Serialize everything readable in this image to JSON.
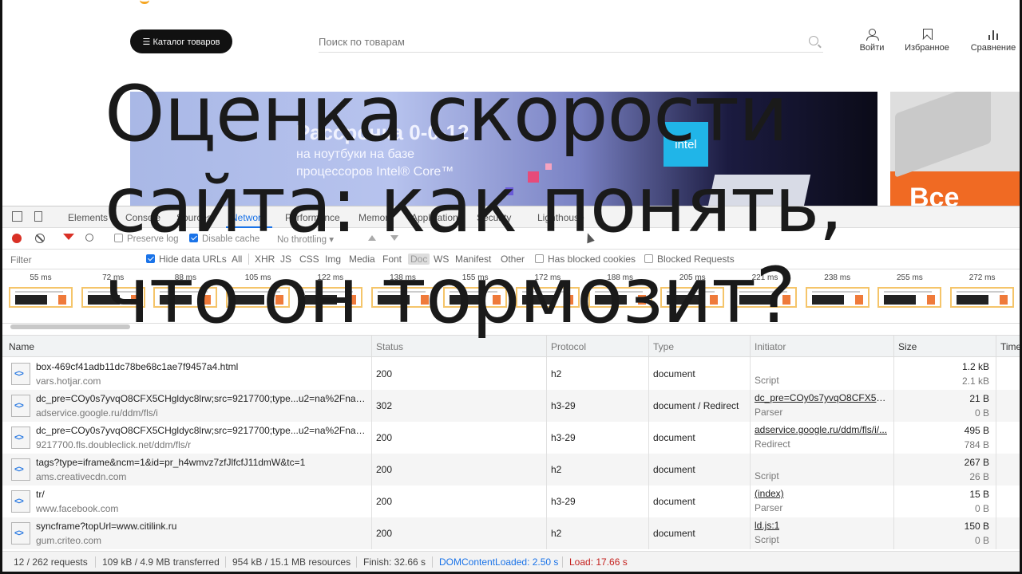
{
  "site": {
    "catalog_label": "☰ Каталог товаров",
    "search_placeholder": "Поиск по товарам",
    "actions": {
      "login": "Войти",
      "favorites": "Избранное",
      "compare": "Сравнение"
    },
    "banner": {
      "title": "Рассрочка 0-0-12",
      "line1": "на ноутбуки на базе",
      "line2": "процессоров Intel® Core™",
      "badge": "intel"
    },
    "side_banner": {
      "text": "Все"
    }
  },
  "devtools": {
    "tabs": [
      "Elements",
      "Console",
      "Sources",
      "Network",
      "Performance",
      "Memory",
      "Application",
      "Security",
      "Lighthouse"
    ],
    "active_tab": "Network",
    "toolbar": {
      "preserve_log": "Preserve log",
      "disable_cache": "Disable cache",
      "throttling": "No throttling"
    },
    "filter": {
      "placeholder": "Filter",
      "hide_data_urls": "Hide data URLs",
      "types": [
        "All",
        "XHR",
        "JS",
        "CSS",
        "Img",
        "Media",
        "Font",
        "Doc",
        "WS",
        "Manifest",
        "Other"
      ],
      "selected_type": "Doc",
      "has_blocked_cookies": "Has blocked cookies",
      "blocked_requests": "Blocked Requests"
    },
    "filmstrip": [
      "55 ms",
      "72 ms",
      "88 ms",
      "105 ms",
      "122 ms",
      "138 ms",
      "155 ms",
      "172 ms",
      "188 ms",
      "205 ms",
      "221 ms",
      "238 ms",
      "255 ms",
      "272 ms"
    ],
    "columns": {
      "name": "Name",
      "status": "Status",
      "protocol": "Protocol",
      "type": "Type",
      "initiator": "Initiator",
      "size": "Size",
      "time": "Time"
    },
    "rows": [
      {
        "name": "box-469cf41adb11dc78be68c1ae7f9457a4.html",
        "domain": "vars.hotjar.com",
        "status": "200",
        "protocol": "h2",
        "type": "document",
        "initiator": "",
        "initiator_type": "Script",
        "size": "1.2 kB",
        "resource": "2.1 kB"
      },
      {
        "name": "dc_pre=COy0s7yvqO8CFX5CHgldyc8lrw;src=9217700;type...u2=na%2Fna;~or...",
        "domain": "adservice.google.ru/ddm/fls/i",
        "status": "302",
        "protocol": "h3-29",
        "type": "document / Redirect",
        "initiator": "dc_pre=COy0s7yvqO8CFX5CH...",
        "initiator_type": "Parser",
        "size": "21 B",
        "resource": "0 B"
      },
      {
        "name": "dc_pre=COy0s7yvqO8CFX5CHgldyc8lrw;src=9217700;type...u2=na%2Fna;~or...",
        "domain": "9217700.fls.doubleclick.net/ddm/fls/r",
        "status": "200",
        "protocol": "h3-29",
        "type": "document",
        "initiator": "adservice.google.ru/ddm/fls/i/...",
        "initiator_type": "Redirect",
        "size": "495 B",
        "resource": "784 B"
      },
      {
        "name": "tags?type=iframe&ncm=1&id=pr_h4wmvz7zfJlfcfJ11dmW&tc=1",
        "domain": "ams.creativecdn.com",
        "status": "200",
        "protocol": "h2",
        "type": "document",
        "initiator": "",
        "initiator_type": "Script",
        "size": "267 B",
        "resource": "26 B"
      },
      {
        "name": "tr/",
        "domain": "www.facebook.com",
        "status": "200",
        "protocol": "h3-29",
        "type": "document",
        "initiator": "(index)",
        "initiator_type": "Parser",
        "size": "15 B",
        "resource": "0 B"
      },
      {
        "name": "syncframe?topUrl=www.citilink.ru",
        "domain": "gum.criteo.com",
        "status": "200",
        "protocol": "h2",
        "type": "document",
        "initiator": "ld.js:1",
        "initiator_type": "Script",
        "size": "150 B",
        "resource": "0 B"
      }
    ],
    "status_bar": {
      "requests": "12 / 262 requests",
      "transferred": "109 kB / 4.9 MB transferred",
      "resources": "954 kB / 15.1 MB resources",
      "finish": "Finish: 32.66 s",
      "dom_content_loaded": "DOMContentLoaded: 2.50 s",
      "load": "Load: 17.66 s",
      "dcl_color": "#1a73e8",
      "load_color": "#c5221f"
    }
  },
  "overlay": {
    "line1": "Оценка скорости",
    "line2": "сайта: как понять,",
    "line3": "что он тормозит?"
  }
}
